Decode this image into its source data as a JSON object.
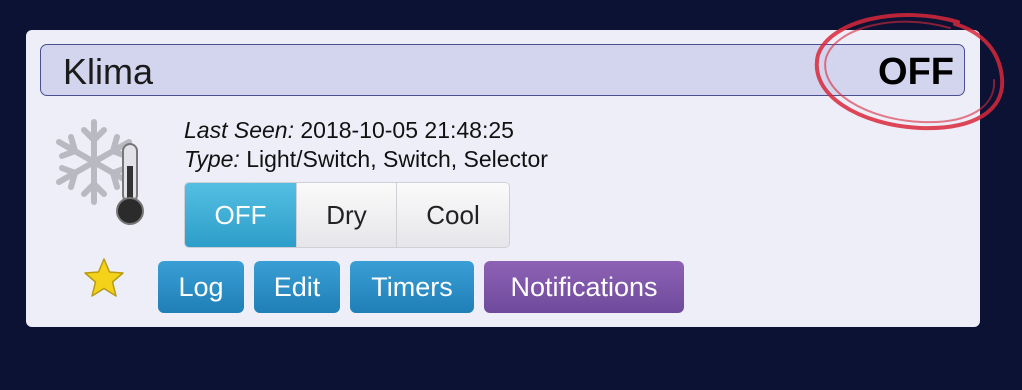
{
  "device": {
    "name": "Klima",
    "status": "OFF",
    "icon": "snowflake-thermometer-icon",
    "last_seen_label": "Last Seen:",
    "last_seen_value": "2018-10-05 21:48:25",
    "type_label": "Type:",
    "type_value": "Light/Switch, Switch, Selector"
  },
  "selector": {
    "options": [
      "OFF",
      "Dry",
      "Cool"
    ],
    "selected": "OFF"
  },
  "favorite": {
    "icon": "star-icon",
    "color": "#f5d21a"
  },
  "actions": {
    "log": "Log",
    "edit": "Edit",
    "timers": "Timers",
    "notifications": "Notifications"
  },
  "colors": {
    "background": "#0b1233",
    "card": "#eeeef9",
    "header": "#d3d5ee",
    "selected_button": "#2d9dc9",
    "action_button": "#2a8ec6",
    "notifications_button": "#7d55a8",
    "annotation": "#d8283a"
  }
}
